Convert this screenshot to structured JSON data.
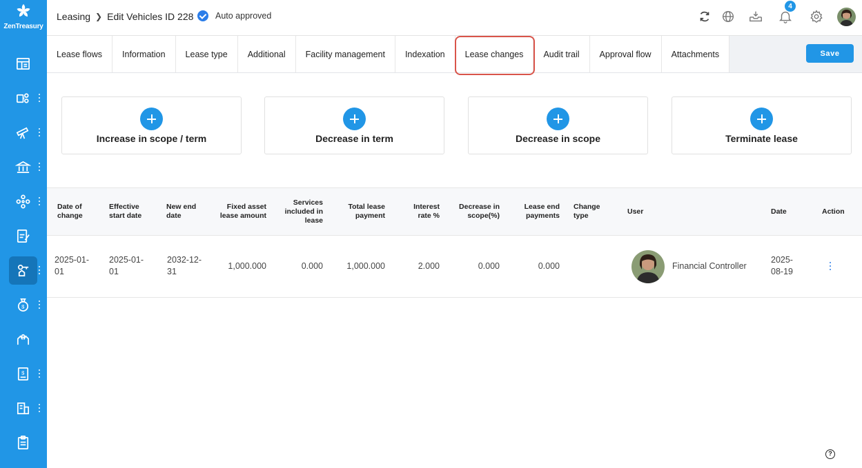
{
  "app": {
    "logo_text": "ZenTreasury"
  },
  "header": {
    "breadcrumb_root": "Leasing",
    "breadcrumb_current": "Edit Vehicles ID 228",
    "status": "Auto approved",
    "notification_count": "4",
    "icons": [
      "refresh-icon",
      "globe-icon",
      "inbox-download-icon",
      "bell-icon",
      "gear-icon"
    ]
  },
  "tabs": [
    {
      "label": "Lease flows"
    },
    {
      "label": "Information"
    },
    {
      "label": "Lease type"
    },
    {
      "label": "Additional"
    },
    {
      "label": "Facility management"
    },
    {
      "label": "Indexation"
    },
    {
      "label": "Lease changes",
      "active": true
    },
    {
      "label": "Audit trail"
    },
    {
      "label": "Approval flow"
    },
    {
      "label": "Attachments"
    }
  ],
  "save_label": "Save",
  "actions": [
    {
      "label": "Increase in scope / term"
    },
    {
      "label": "Decrease in term"
    },
    {
      "label": "Decrease in scope"
    },
    {
      "label": "Terminate lease"
    }
  ],
  "table": {
    "headers": {
      "date_of_change": "Date of change",
      "effective_start": "Effective start date",
      "new_end": "New end date",
      "fixed_asset": "Fixed asset lease amount",
      "services": "Services included in lease",
      "total_payment": "Total lease payment",
      "interest": "Interest rate %",
      "decrease_scope": "Decrease in scope(%)",
      "end_payments": "Lease end payments",
      "change_type": "Change type",
      "user": "User",
      "date": "Date",
      "action": "Action"
    },
    "rows": [
      {
        "date_of_change": "2025-01-01",
        "effective_start": "2025-01-01",
        "new_end": "2032-12-31",
        "fixed_asset": "1,000.000",
        "services": "0.000",
        "total_payment": "1,000.000",
        "interest": "2.000",
        "decrease_scope": "0.000",
        "end_payments": "0.000",
        "change_type": "",
        "user": "Financial Controller",
        "date": "2025-08-19"
      }
    ]
  },
  "colors": {
    "accent": "#2196e6",
    "active_outline": "#d9544a",
    "sidebar_active": "#1575b9"
  }
}
